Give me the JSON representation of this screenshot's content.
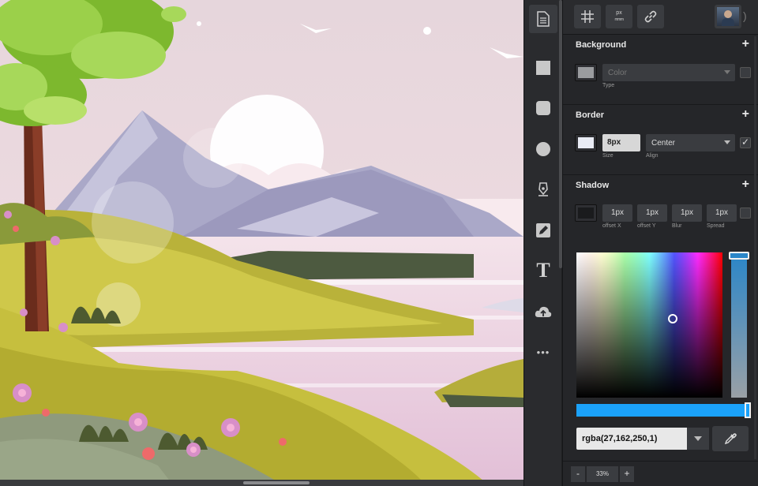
{
  "panel": {
    "background": {
      "title": "Background",
      "add_icon": "plus-icon",
      "type_value": "Color",
      "type_label": "Type",
      "swatch_color": "#9a9c9f"
    },
    "border": {
      "title": "Border",
      "add_icon": "plus-icon",
      "size_value": "8px",
      "size_label": "Size",
      "align_value": "Center",
      "align_label": "Align",
      "swatch_color": "#e9ecf5",
      "enabled": true
    },
    "shadow": {
      "title": "Shadow",
      "add_icon": "plus-icon",
      "swatch_color": "#1a1b1d",
      "fields": [
        {
          "value": "1px",
          "label": "offset X"
        },
        {
          "value": "1px",
          "label": "offset Y"
        },
        {
          "value": "1px",
          "label": "Blur"
        },
        {
          "value": "1px",
          "label": "Spread"
        }
      ]
    },
    "color_picker": {
      "value": "rgba(27,162,250,1)",
      "color": "#1ba2fa"
    },
    "zoom": {
      "minus": "-",
      "value": "33%",
      "plus": "+"
    },
    "top_toolbar": {
      "grid_icon": "grid-icon",
      "units_label_top": "px",
      "units_label_bottom": "mmm",
      "link_icon": "link-icon",
      "avatar": "user-avatar"
    }
  },
  "tools": [
    {
      "name": "page-icon"
    },
    {
      "name": "square-icon"
    },
    {
      "name": "rounded-square-icon"
    },
    {
      "name": "circle-icon"
    },
    {
      "name": "pen-tool-icon"
    },
    {
      "name": "pencil-icon"
    },
    {
      "name": "text-icon",
      "label": "T"
    },
    {
      "name": "upload-cloud-icon"
    },
    {
      "name": "more-icon",
      "label": "•••"
    }
  ]
}
